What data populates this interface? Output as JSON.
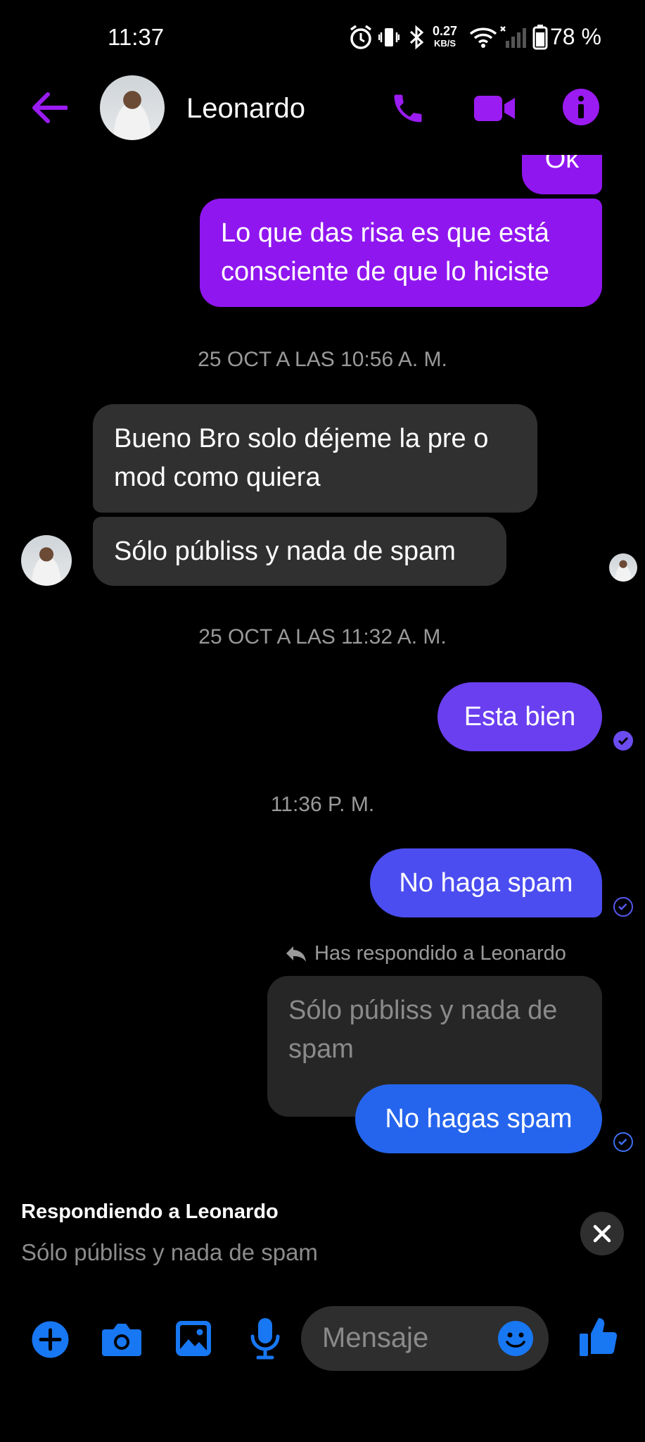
{
  "status_bar": {
    "time": "11:37",
    "network_speed_value": "0.27",
    "network_speed_unit": "KB/S",
    "battery_percent": "78 %"
  },
  "header": {
    "contact_name": "Leonardo",
    "accent_color": "#9b1cf2"
  },
  "messages": {
    "partial_out": "Ok",
    "out_1": "Lo que das risa es que está consciente de que lo hiciste",
    "timestamp_1": "25 OCT A LAS 10:56 A. M.",
    "in_1": "Bueno Bro solo déjeme la pre o mod como quiera",
    "in_2": "Sólo públiss y nada de spam",
    "timestamp_2": "25 OCT A LAS 11:32 A. M.",
    "out_2": "Esta bien",
    "timestamp_3": "11:36 P. M.",
    "out_3": "No haga spam",
    "reply_notice": "Has respondido a Leonardo",
    "quoted": "Sólo públiss y nada de spam",
    "out_4": "No hagas spam"
  },
  "composer": {
    "reply_title": "Respondiendo a Leonardo",
    "reply_preview": "Sólo públiss y nada de spam",
    "placeholder": "Mensaje"
  },
  "icons": [
    "back-arrow-icon",
    "phone-icon",
    "video-camera-icon",
    "info-icon",
    "plus-icon",
    "camera-icon",
    "gallery-icon",
    "microphone-icon",
    "emoji-icon",
    "like-icon",
    "close-icon"
  ]
}
